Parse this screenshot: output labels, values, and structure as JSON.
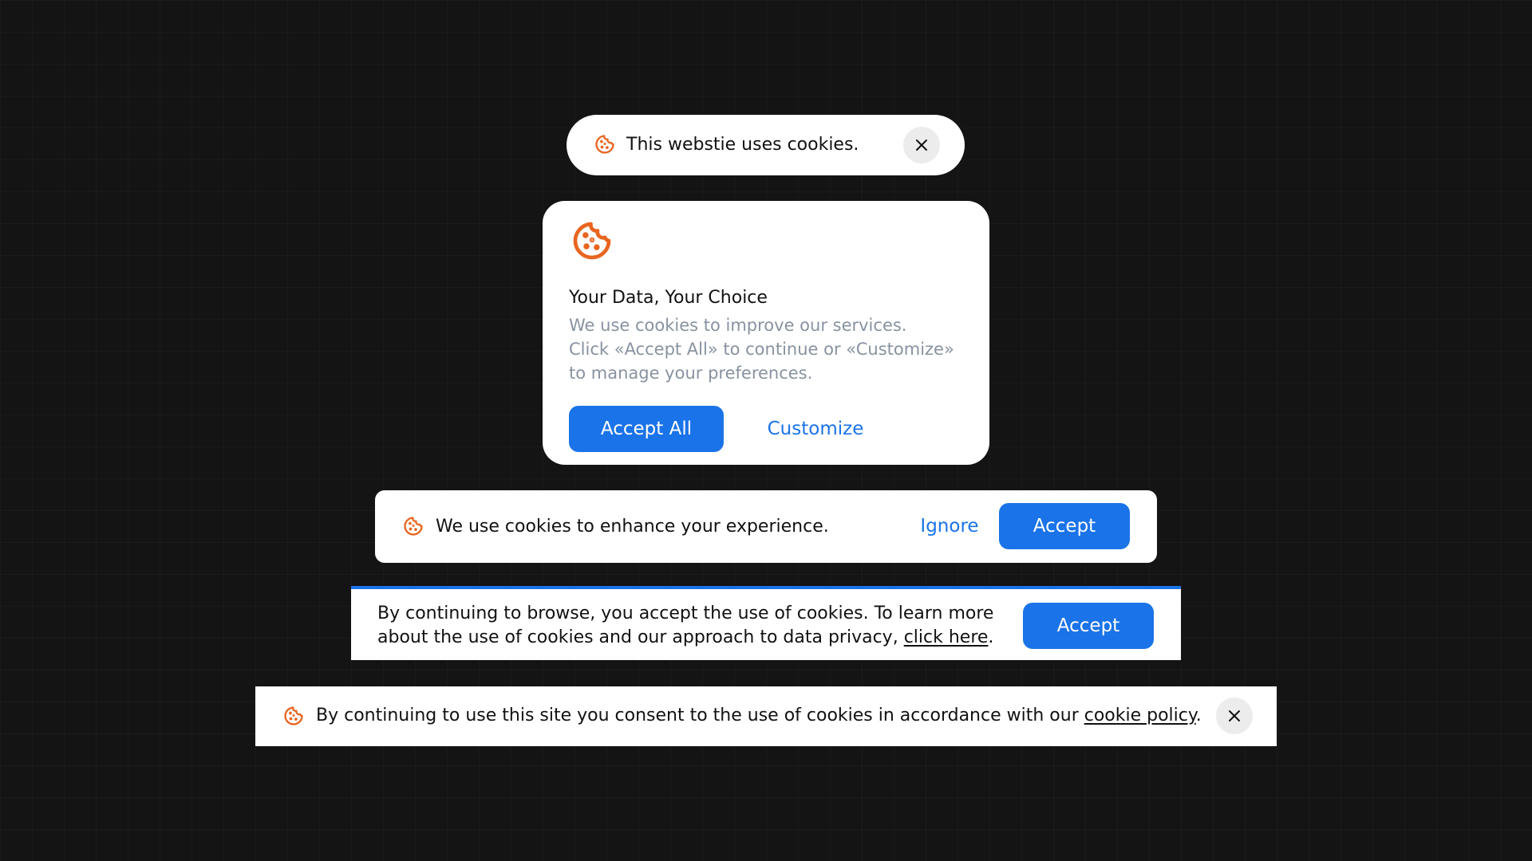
{
  "colors": {
    "background": "#141414",
    "accent": "#1a73e8",
    "icon": "#e8651f",
    "muted_text": "#8892a0"
  },
  "icons": {
    "cookie": "cookie-icon",
    "close": "close-icon"
  },
  "pill_banner": {
    "text": "This webstie uses cookies."
  },
  "choice_card": {
    "title": "Your Data, Your Choice",
    "body_lines": [
      "We use cookies to improve our services.",
      "Click «Accept All» to continue or «Customize»",
      "to manage your preferences."
    ],
    "accept_label": "Accept All",
    "customize_label": "Customize"
  },
  "experience_banner": {
    "text": "We use cookies to enhance your experience.",
    "ignore_label": "Ignore",
    "accept_label": "Accept"
  },
  "browse_banner": {
    "line1": "By continuing to browse, you accept the use of cookies. To learn more",
    "line2_prefix": "about the use of cookies and our approach to data privacy, ",
    "link": "click here",
    "line2_suffix": ".",
    "accept_label": "Accept"
  },
  "consent_banner": {
    "text_prefix": "By continuing to use this site you consent to the use of cookies in accordance with our ",
    "link": "cookie policy",
    "text_suffix": "."
  }
}
